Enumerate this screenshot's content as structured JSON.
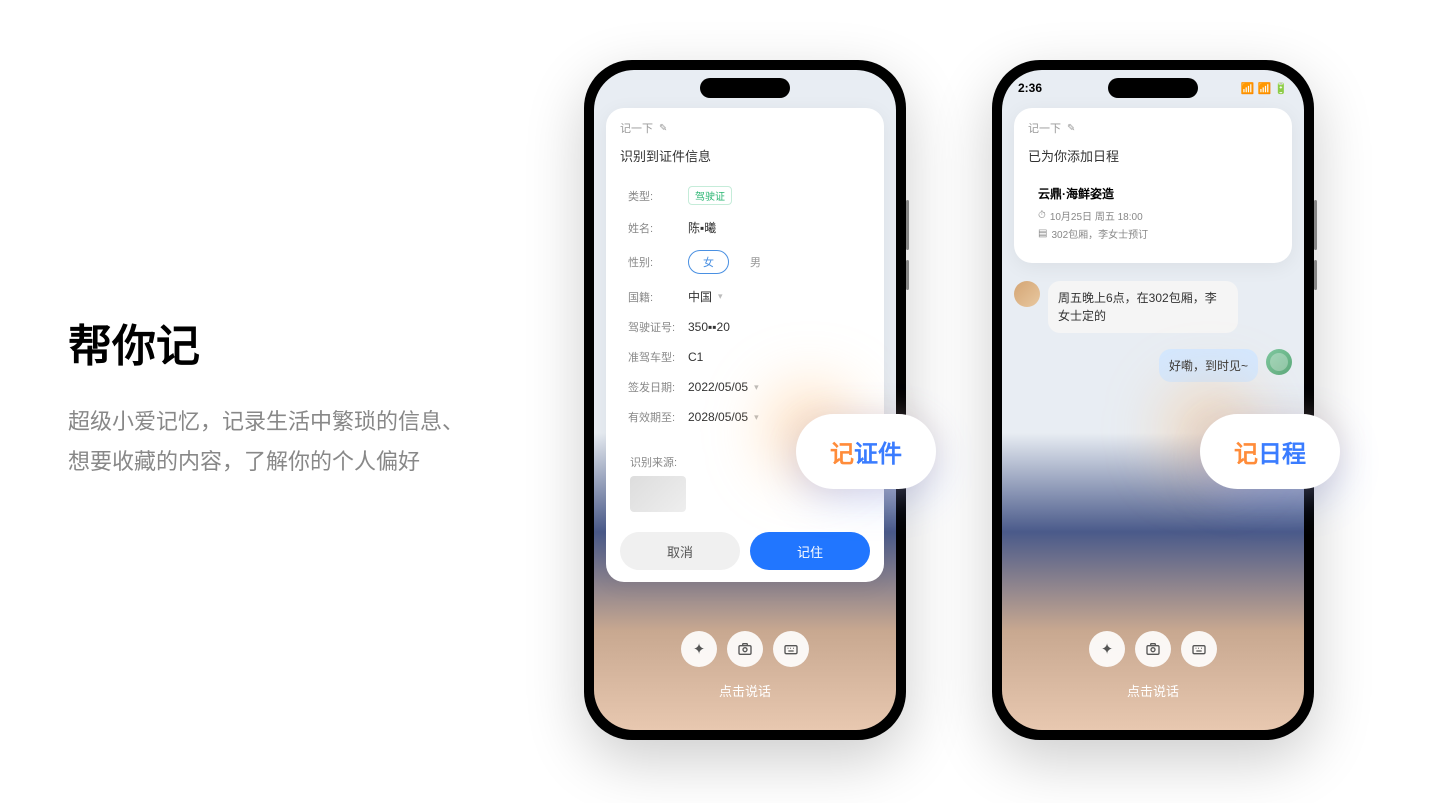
{
  "left": {
    "title": "帮你记",
    "desc": "超级小爱记忆，记录生活中繁琐的信息、 想要收藏的内容，了解你的个人偏好"
  },
  "phone1": {
    "card_header": "记一下",
    "card_title": "识别到证件信息",
    "fields": {
      "type_label": "类型:",
      "type_value": "驾驶证",
      "name_label": "姓名:",
      "name_value": "陈▪曦",
      "gender_label": "性别:",
      "gender_female": "女",
      "gender_male": "男",
      "nation_label": "国籍:",
      "nation_value": "中国",
      "license_label": "驾驶证号:",
      "license_value": "350▪▪20",
      "class_label": "准驾车型:",
      "class_value": "C1",
      "issue_label": "签发日期:",
      "issue_value": "2022/05/05",
      "valid_label": "有效期至:",
      "valid_value": "2028/05/05"
    },
    "source_label": "识别来源:",
    "btn_cancel": "取消",
    "btn_confirm": "记住",
    "tap_text": "点击说话"
  },
  "phone2": {
    "time": "2:36",
    "card_header": "记一下",
    "card_title": "已为你添加日程",
    "event": {
      "title": "云鼎·海鲜姿造",
      "time": "10月25日 周五 18:00",
      "note": "302包厢，李女士预订"
    },
    "msg_in": "周五晚上6点，在302包厢，李女士定的",
    "msg_out": "好嘞，到时见~",
    "tap_text": "点击说话"
  },
  "pill1": {
    "a": "记",
    "b": "证件"
  },
  "pill2": {
    "a": "记",
    "b": "日程"
  }
}
